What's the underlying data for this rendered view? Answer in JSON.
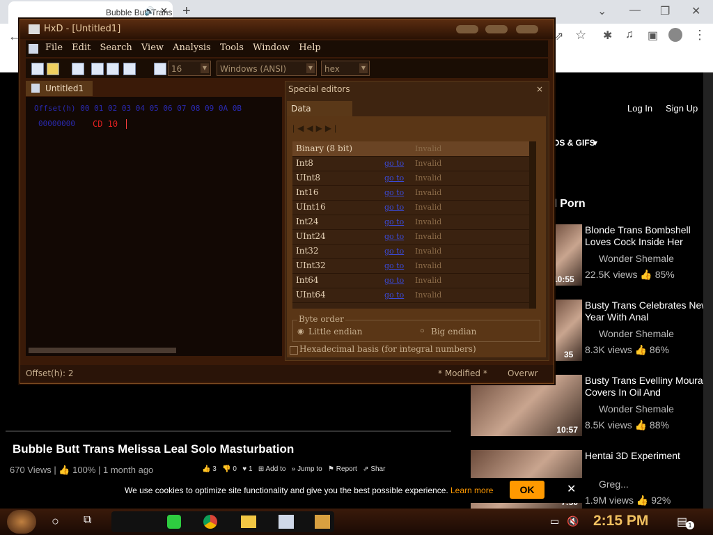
{
  "browser": {
    "tab_title": "Bubble Butt Trans Melissa",
    "new_tab": "+",
    "window_controls": [
      "⌄",
      "—",
      "❐",
      "✕"
    ],
    "site_links": {
      "login": "Log In",
      "signup": "Sign Up"
    },
    "nav_item": "OS & GIFS",
    "section_heading": "d Porn"
  },
  "video": {
    "title": "Bubble Butt Trans Melissa Leal Solo Masturbation",
    "views": "670 Views",
    "rating": "100%",
    "age": "1 month ago",
    "likes": "3",
    "dislikes": "0",
    "favs": "1",
    "add_to": "Add to",
    "jump_to": "Jump to",
    "report": "Report",
    "share": "Shar"
  },
  "related": [
    {
      "title": "Blonde Trans Bombshell Loves Cock Inside Her",
      "channel": "Wonder Shemale",
      "views": "22.5K views",
      "rating": "85%",
      "duration": "10:55"
    },
    {
      "title": "Busty Trans Celebrates New Year With Anal",
      "channel": "Wonder Shemale",
      "views": "8.3K views",
      "rating": "86%",
      "duration": "35"
    },
    {
      "title": "Busty Trans Evelliny Moura Covers In Oil And",
      "channel": "Wonder Shemale",
      "views": "8.5K views",
      "rating": "88%",
      "duration": "10:57"
    },
    {
      "title": "Hentai 3D Experiment",
      "channel": "Greg...",
      "views": "1.9M views",
      "rating": "92%",
      "duration": "7:50"
    }
  ],
  "cookie": {
    "text": "We use cookies to optimize site functionality and give you the best possible experience.",
    "link": "Learn more",
    "ok": "OK"
  },
  "hxd": {
    "title": "HxD - [Untitled1]",
    "menu": [
      "File",
      "Edit",
      "Search",
      "View",
      "Analysis",
      "Tools",
      "Window",
      "Help"
    ],
    "bytes_per_row": "16",
    "charset": "Windows (ANSI)",
    "display": "hex",
    "doc_tab": "Untitled1",
    "editor_header": "Offset(h) 00 01 02 03 04 05 06 07 08 09 0A 0B",
    "editor_row_offset": "00000000",
    "editor_row_bytes": "CD 10",
    "special_title": "Special editors",
    "data_inspector_tab": "Data inspector",
    "inspector_rows": [
      {
        "name": "Binary (8 bit)",
        "link": "",
        "value": "Invalid"
      },
      {
        "name": "Int8",
        "link": "go to",
        "value": "Invalid"
      },
      {
        "name": "UInt8",
        "link": "go to",
        "value": "Invalid"
      },
      {
        "name": "Int16",
        "link": "go to",
        "value": "Invalid"
      },
      {
        "name": "UInt16",
        "link": "go to",
        "value": "Invalid"
      },
      {
        "name": "Int24",
        "link": "go to",
        "value": "Invalid"
      },
      {
        "name": "UInt24",
        "link": "go to",
        "value": "Invalid"
      },
      {
        "name": "Int32",
        "link": "go to",
        "value": "Invalid"
      },
      {
        "name": "UInt32",
        "link": "go to",
        "value": "Invalid"
      },
      {
        "name": "Int64",
        "link": "go to",
        "value": "Invalid"
      },
      {
        "name": "UInt64",
        "link": "go to",
        "value": "Invalid"
      }
    ],
    "byte_order_label": "Byte order",
    "little_endian": "Little endian",
    "big_endian": "Big endian",
    "hex_basis": "Hexadecimal basis (for integral numbers)",
    "status_offset": "Offset(h): 2",
    "status_modified": "* Modified *",
    "status_mode": "Overwr"
  },
  "taskbar": {
    "time": "2:15 PM",
    "notification_count": "1"
  }
}
